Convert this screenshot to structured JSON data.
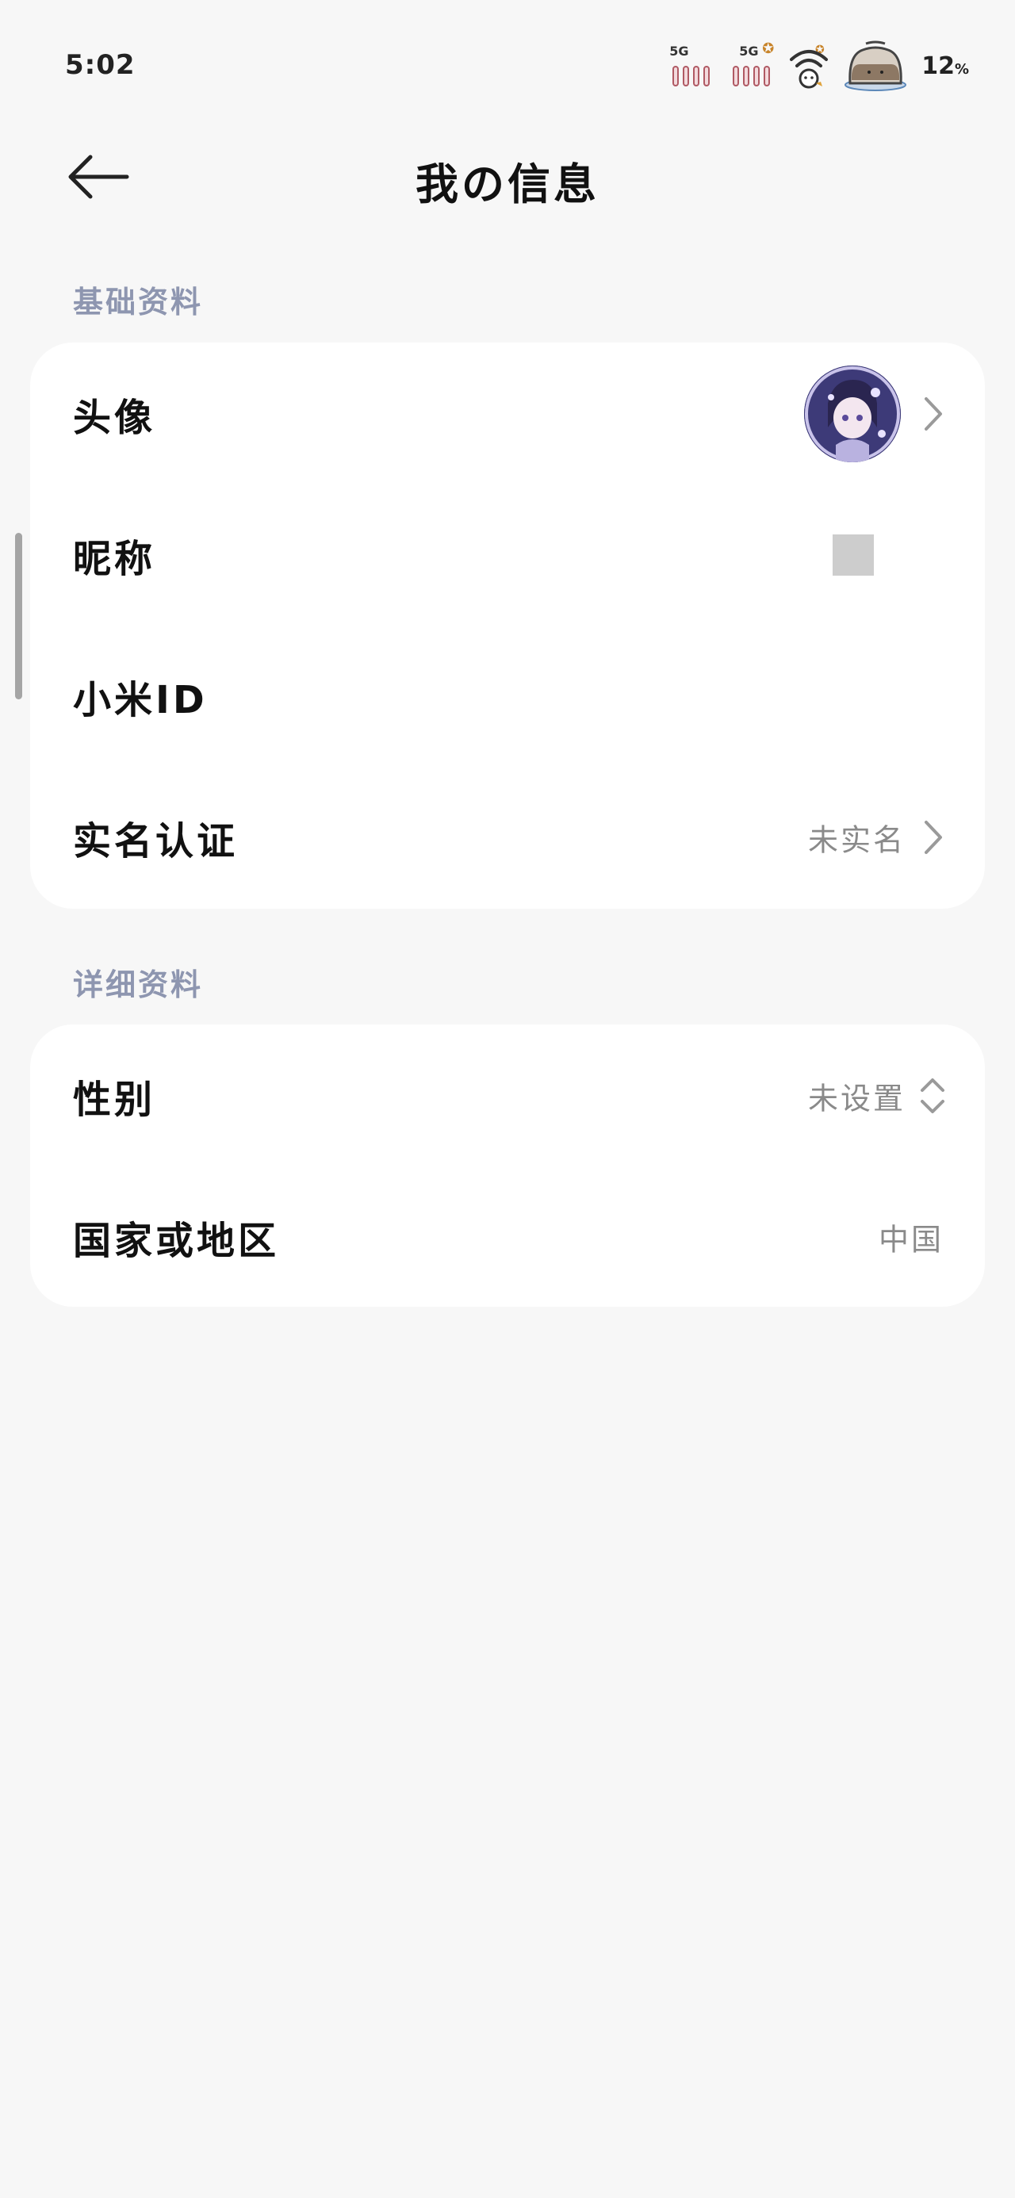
{
  "status_bar": {
    "time": "5:02",
    "sim1_tag": "5G",
    "sim2_tag": "5G",
    "battery_percent": "12",
    "battery_unit": "%"
  },
  "header": {
    "title": "我の信息"
  },
  "sections": {
    "basic": {
      "label": "基础资料",
      "rows": {
        "avatar": {
          "label": "头像"
        },
        "nickname": {
          "label": "昵称"
        },
        "xiaomi_id": {
          "label": "小米ID"
        },
        "real_name": {
          "label": "实名认证",
          "value": "未实名"
        }
      }
    },
    "detail": {
      "label": "详细资料",
      "rows": {
        "gender": {
          "label": "性别",
          "value": "未设置"
        },
        "region": {
          "label": "国家或地区",
          "value": "中国"
        }
      }
    }
  },
  "colors": {
    "background": "#f7f7f7",
    "card": "#ffffff",
    "section_label": "#8e96b0",
    "value_text": "#8a8a8a"
  },
  "icons": {
    "back": "arrow-left-icon",
    "chevron": "chevron-right-icon",
    "updown": "chevron-up-down-icon",
    "wifi": "wifi-icon",
    "battery": "battery-icon",
    "signal": "signal-icon"
  }
}
